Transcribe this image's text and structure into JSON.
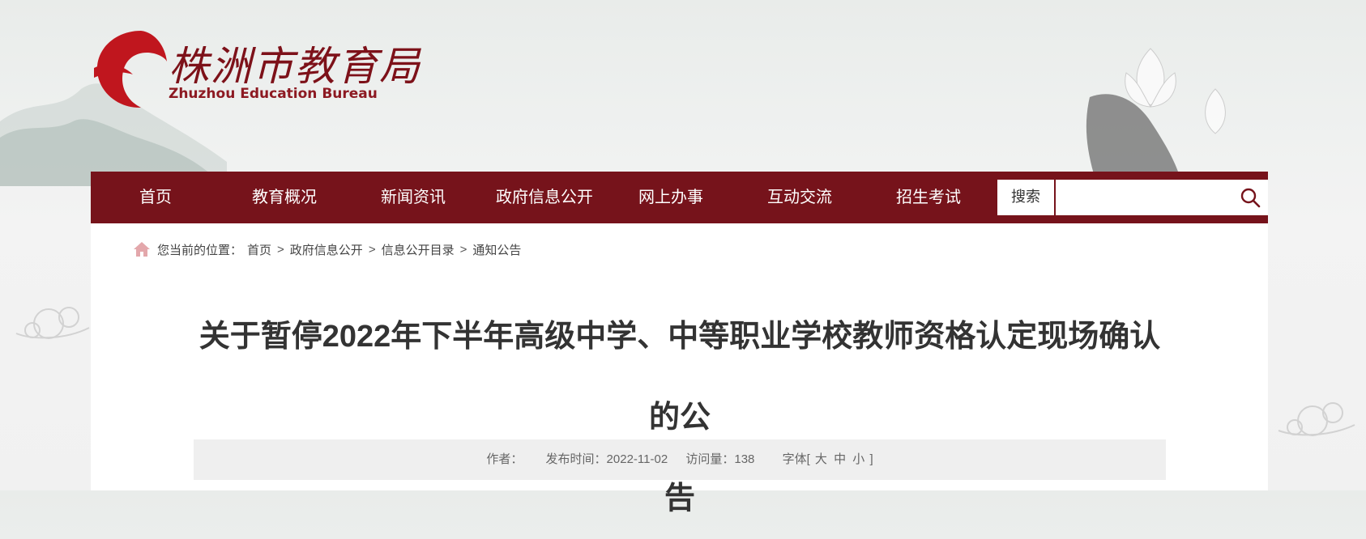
{
  "header": {
    "logo_cn": "株洲市教育局",
    "logo_en": "Zhuzhou Education Bureau"
  },
  "nav": {
    "items": [
      "首页",
      "教育概况",
      "新闻资讯",
      "政府信息公开",
      "网上办事",
      "互动交流",
      "招生考试"
    ],
    "search_label": "搜索",
    "search_placeholder": ""
  },
  "breadcrumb": {
    "prefix": "您当前的位置：",
    "items": [
      "首页",
      "政府信息公开",
      "信息公开目录",
      "通知公告"
    ],
    "separator": ">"
  },
  "article": {
    "title_line1": "关于暂停2022年下半年高级中学、中等职业学校教师资格认定现场确认的公",
    "title_line2": "告",
    "author_label": "作者：",
    "author": "",
    "date_label": "发布时间：",
    "date": "2022-11-02",
    "views_label": "访问量：",
    "views": "138",
    "font_label": "字体[",
    "font_large": "大",
    "font_medium": "中",
    "font_small": "小",
    "font_end": "]"
  },
  "colors": {
    "brand": "#76131b",
    "logo_red": "#c0161e",
    "home_icon": "#e3a7ab"
  },
  "icons": {
    "home": "home-icon",
    "search": "search-icon"
  }
}
